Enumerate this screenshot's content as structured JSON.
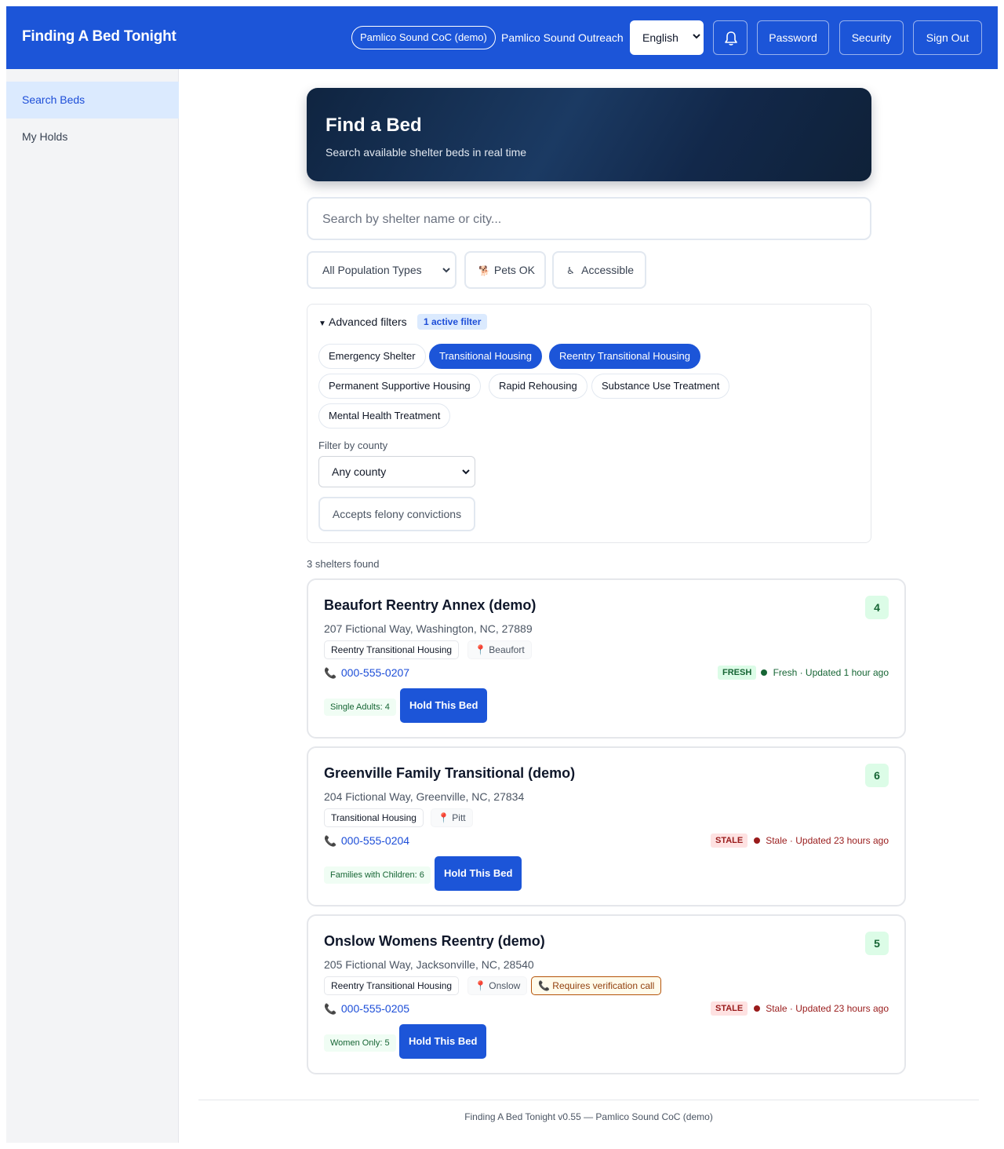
{
  "header": {
    "brand": "Finding A Bed Tonight",
    "coc": "Pamlico Sound CoC (demo)",
    "org": "Pamlico Sound Outreach",
    "language": "English",
    "bell_icon": "bell-icon",
    "password_label": "Password",
    "security_label": "Security",
    "signout_label": "Sign Out",
    "accent": "#1c55d8"
  },
  "sidebar": {
    "items": [
      {
        "label": "Search Beds",
        "active": true
      },
      {
        "label": "My Holds",
        "active": false
      }
    ]
  },
  "hero": {
    "title": "Find a Bed",
    "subtitle": "Search available shelter beds in real time"
  },
  "search": {
    "placeholder": "Search by shelter name or city..."
  },
  "filters": {
    "population": "All Population Types",
    "pets": {
      "icon": "🐕",
      "label": "Pets OK"
    },
    "accessible": {
      "icon": "♿",
      "label": "Accessible"
    }
  },
  "advanced": {
    "toggle": "▼",
    "title": "Advanced filters",
    "badge": "1 active filter",
    "chips": [
      {
        "label": "Emergency Shelter",
        "active": false
      },
      {
        "label": "Transitional Housing",
        "active": true
      },
      {
        "label": "Reentry Transitional Housing",
        "active": true
      },
      {
        "label": "Permanent Supportive Housing",
        "active": false
      },
      {
        "label": "Rapid Rehousing",
        "active": false
      },
      {
        "label": "Substance Use Treatment",
        "active": false
      },
      {
        "label": "Mental Health Treatment",
        "active": false
      }
    ],
    "county_label": "Filter by county",
    "county_value": "Any county",
    "felony_label": "Accepts felony convictions"
  },
  "results": {
    "count_text": "3 shelters found",
    "cards": [
      {
        "name": "Beaufort Reentry Annex (demo)",
        "count": "4",
        "address": "207 Fictional Way, Washington, NC, 27889",
        "type": "Reentry Transitional Housing",
        "county": "Beaufort",
        "verify": "",
        "phone": "000-555-0207",
        "freshness_badge": "FRESH",
        "freshness_text": "Fresh · Updated 1 hour ago",
        "freshness": "fresh",
        "population": "Single Adults: 4",
        "hold_label": "Hold This Bed"
      },
      {
        "name": "Greenville Family Transitional (demo)",
        "count": "6",
        "address": "204 Fictional Way, Greenville, NC, 27834",
        "type": "Transitional Housing",
        "county": "Pitt",
        "verify": "",
        "phone": "000-555-0204",
        "freshness_badge": "STALE",
        "freshness_text": "Stale · Updated 23 hours ago",
        "freshness": "stale",
        "population": "Families with Children: 6",
        "hold_label": "Hold This Bed"
      },
      {
        "name": "Onslow Womens Reentry (demo)",
        "count": "5",
        "address": "205 Fictional Way, Jacksonville, NC, 28540",
        "type": "Reentry Transitional Housing",
        "county": "Onslow",
        "verify": "Requires verification call",
        "phone": "000-555-0205",
        "freshness_badge": "STALE",
        "freshness_text": "Stale · Updated 23 hours ago",
        "freshness": "stale",
        "population": "Women Only: 5",
        "hold_label": "Hold This Bed"
      }
    ]
  },
  "footer": {
    "text": "Finding A Bed Tonight v0.55 — Pamlico Sound CoC (demo)"
  }
}
